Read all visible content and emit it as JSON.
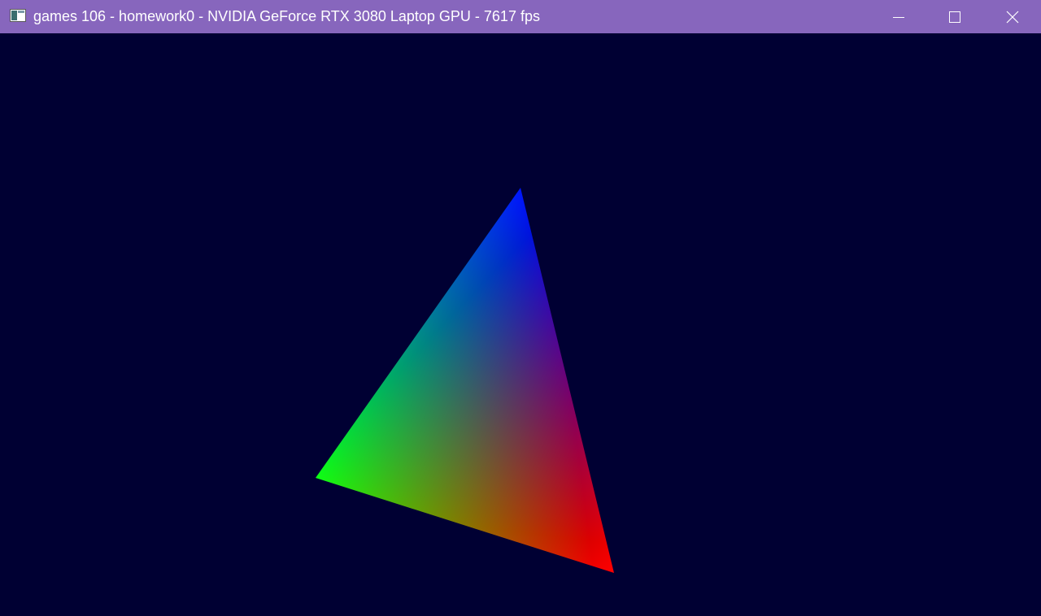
{
  "window": {
    "title": "games 106 - homework0 - NVIDIA GeForce RTX 3080 Laptop GPU - 7617 fps",
    "titlebar_color": "#8766BD",
    "title_text_color": "#FFFFFF",
    "controls": {
      "minimize_icon": "minimize-icon",
      "maximize_icon": "maximize-icon",
      "close_icon": "close-icon"
    }
  },
  "scene": {
    "clear_color": "#000033",
    "triangle": {
      "vertex_colors": {
        "top": "#0000FF",
        "left": "#00FF00",
        "bottom_right": "#FF0000"
      }
    }
  }
}
